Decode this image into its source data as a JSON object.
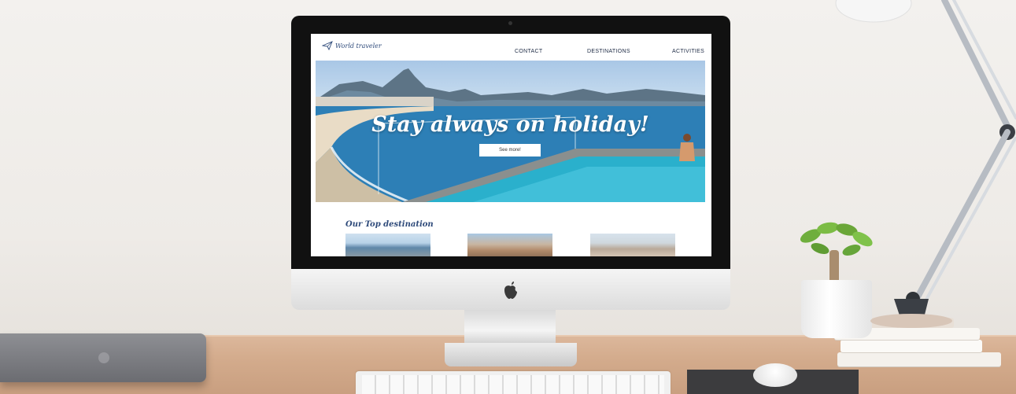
{
  "site": {
    "brand": "World traveler",
    "nav": {
      "contact": "CONTACT",
      "destinations": "DESTINATIONS",
      "activities": "ACTIVITIES"
    },
    "hero": {
      "title": "Stay always on holiday!",
      "button": "See more!"
    },
    "section_title": "Our Top destination"
  },
  "icons": {
    "brand": "paper-plane-icon",
    "device": "apple-logo-icon"
  },
  "colors": {
    "brand_text": "#2e4a7a",
    "nav_text": "#1e2b45",
    "hero_water": "#1f76aa",
    "button_bg": "#ffffff"
  }
}
